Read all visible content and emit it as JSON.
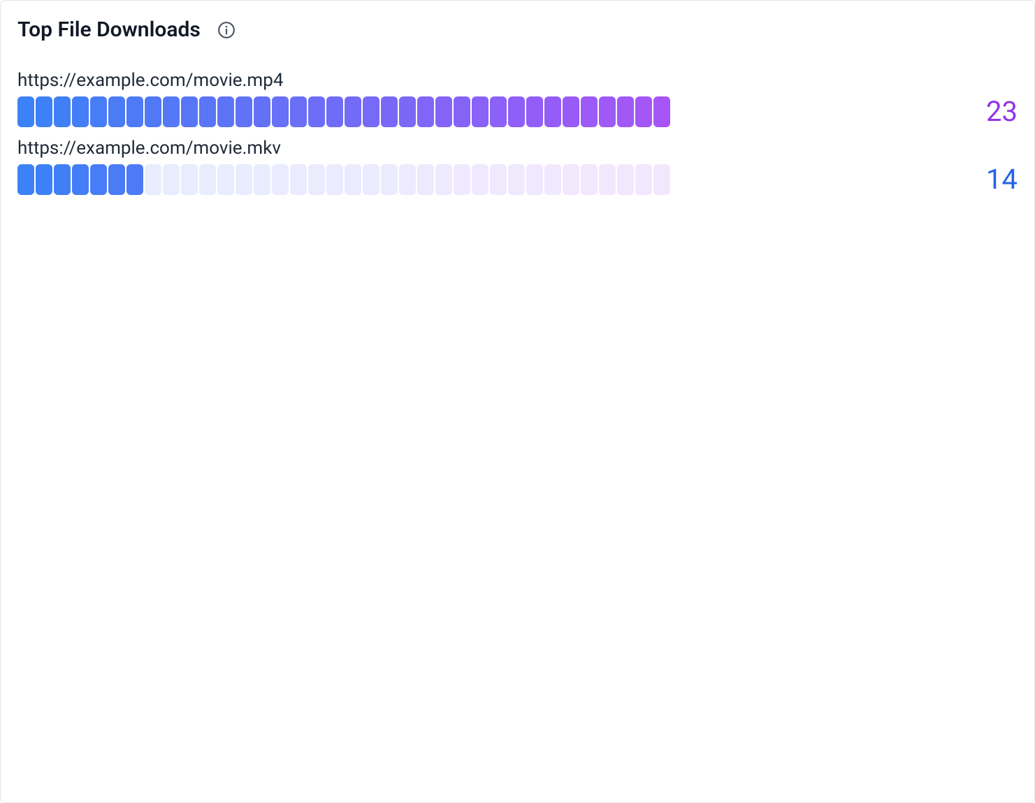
{
  "panel": {
    "title": "Top File Downloads"
  },
  "chart_data": {
    "type": "bar",
    "title": "Top File Downloads",
    "xlabel": "",
    "ylabel": "",
    "segments": 36,
    "gradient_start": "#3b82f6",
    "gradient_end": "#a855f7",
    "series": [
      {
        "name": "https://example.com/movie.mp4",
        "value": 23,
        "value_color": "#9333ea",
        "fill_fraction": 1.0
      },
      {
        "name": "https://example.com/movie.mkv",
        "value": 14,
        "value_color": "#2563eb",
        "fill_fraction": 0.194
      }
    ],
    "ylim": [
      0,
      23
    ]
  }
}
